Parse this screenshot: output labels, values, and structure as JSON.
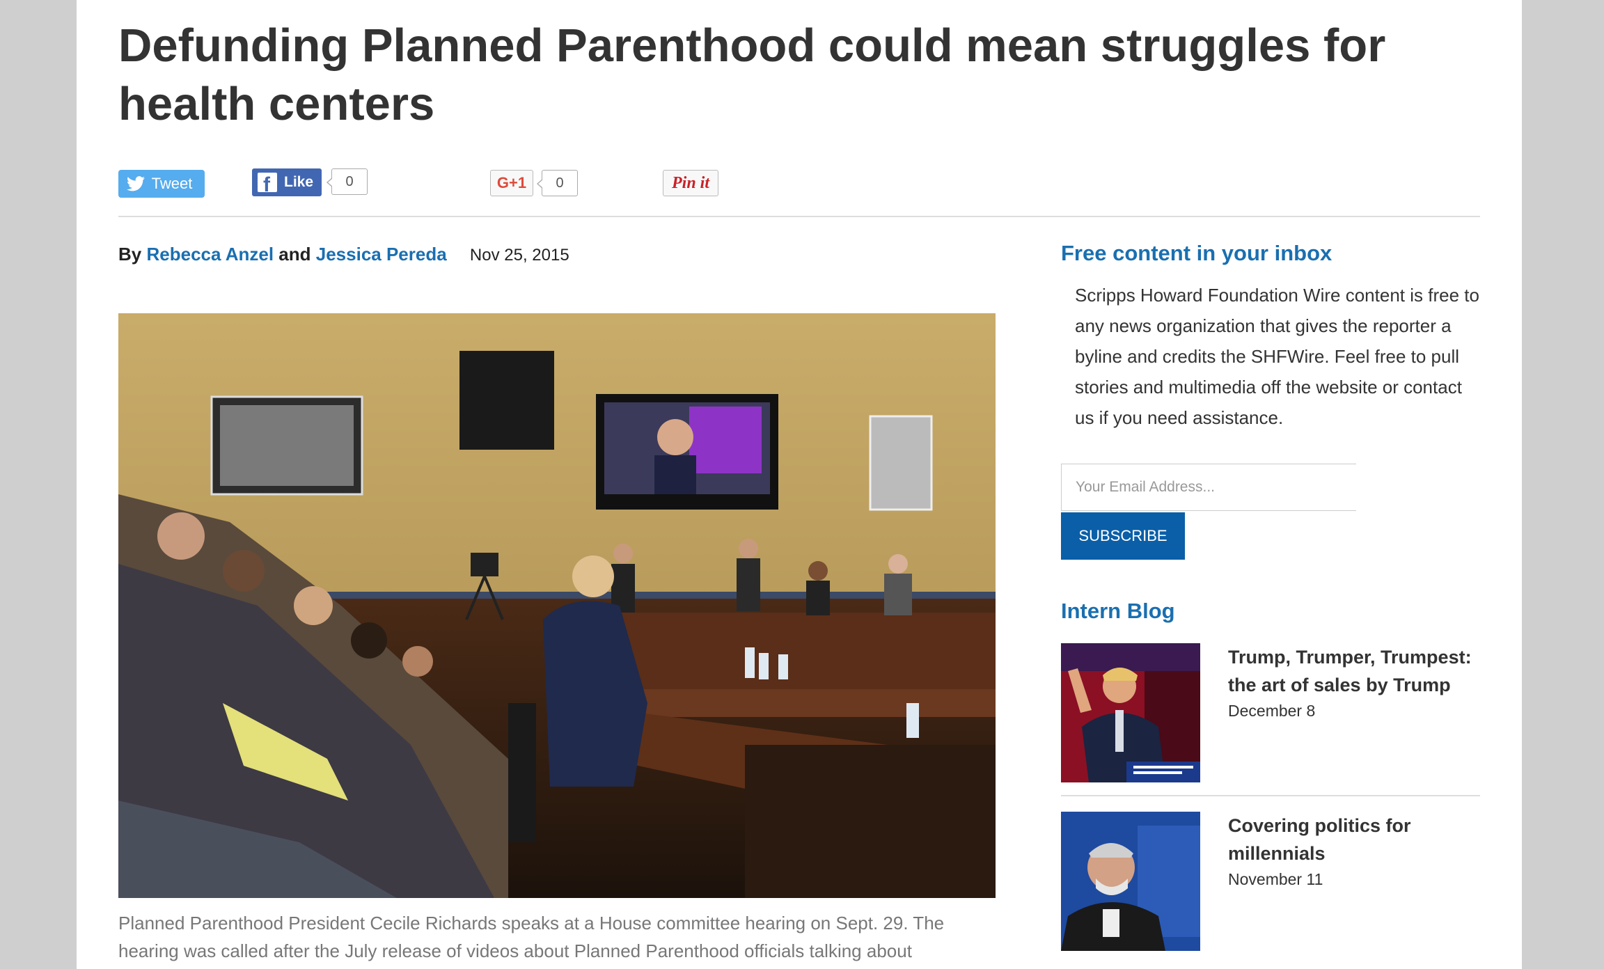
{
  "article": {
    "title": "Defunding Planned Parenthood could mean struggles for health centers",
    "byline_prefix": "By",
    "author1": "Rebecca Anzel",
    "byline_and": "and",
    "author2": "Jessica Pereda",
    "date": "Nov 25, 2015",
    "photo_alt": "House committee hearing room",
    "caption": "Planned Parenthood President Cecile Richards speaks at a House committee hearing on Sept. 29. The hearing was called after the July release of videos about Planned Parenthood officials talking about"
  },
  "social": {
    "tweet_label": "Tweet",
    "like_label": "Like",
    "like_count": "0",
    "gplus_label": "G+1",
    "gplus_count": "0",
    "pin_label": "Pin it"
  },
  "sidebar": {
    "newsletter": {
      "heading": "Free content in your inbox",
      "text": "Scripps Howard Foundation Wire content is free to any news organization that gives the reporter a byline and credits the SHFWire. Feel free to pull stories and multimedia off the website or contact us if you need assistance.",
      "email_placeholder": "Your Email Address...",
      "subscribe_label": "SUBSCRIBE"
    },
    "intern_blog": {
      "heading": "Intern Blog",
      "items": [
        {
          "title": "Trump, Trumper, Trumpest: the art of sales by Trump",
          "date": "December 8"
        },
        {
          "title": "Covering politics for millennials",
          "date": "November 11"
        }
      ]
    }
  },
  "colors": {
    "link": "#1a6fb0",
    "tweet": "#55acee",
    "facebook": "#4267b2",
    "subscribe": "#0a5fa8"
  }
}
